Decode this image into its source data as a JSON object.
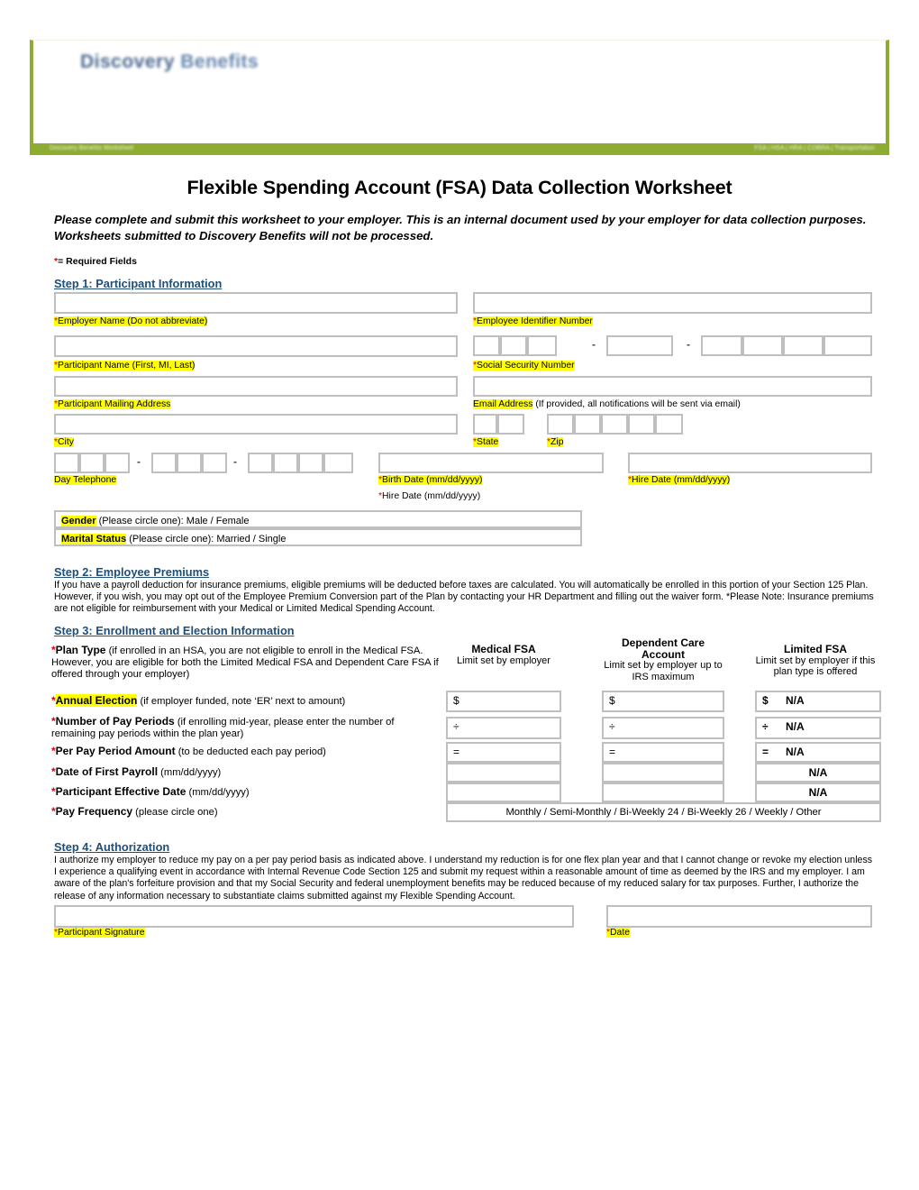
{
  "banner": {
    "logo_primary": "Discovery",
    "logo_secondary": "Benefits",
    "bar_left_text": "Discovery Benefits Worksheet",
    "bar_right_text": "FSA  |  HSA  |  HRA  |  COBRA  |  Transportation"
  },
  "title": "Flexible Spending Account (FSA) Data Collection Worksheet",
  "intro": "Please complete and submit this worksheet to your employer.  This is an internal document used by your employer for data collection purposes.  Worksheets submitted to Discovery Benefits will not be processed.",
  "required_fields_note": "= Required Fields",
  "step1": {
    "heading": "Step 1: Participant Information",
    "employer_name_label": "Employer Name (Do not abbreviate)",
    "employee_id_label": "Employee Identifier Number",
    "participant_name_label": "Participant Name (First, MI, Last)",
    "ssn_label": "Social Security Number",
    "mailing_address_label": "Participant Mailing Address",
    "email_label": "Email Address",
    "email_note": "(If provided, all notifications will be sent via email)",
    "city_label": "City",
    "state_label": "State",
    "zip_label": "Zip",
    "day_telephone_label": "Day Telephone",
    "birth_date_label": "Birth Date (mm/dd/yyyy)",
    "hire_date_label": "Hire Date (mm/dd/yyyy)",
    "hire_date_label_dup": "Hire Date (mm/dd/yyyy)",
    "gender_label": "Gender",
    "gender_note": "(Please circle one): Male  /  Female",
    "marital_label": "Marital Status",
    "marital_note": "(Please circle one): Married  /  Single"
  },
  "step2": {
    "heading": "Step 2: Employee Premiums",
    "body": "If you have a payroll deduction for insurance premiums, eligible premiums will be deducted before taxes are calculated.  You will automatically be enrolled in this portion of your Section 125 Plan.  However, if you wish, you may opt out of the Employee Premium Conversion part of the Plan by contacting your HR Department and filling out the waiver form.  *Please Note: Insurance premiums are not eligible for reimbursement with your Medical or Limited Medical Spending Account."
  },
  "step3": {
    "heading": "Step 3: Enrollment and Election Information",
    "plan_type_bold": "Plan Type",
    "plan_type_note": "(if enrolled in an HSA, you are not eligible to enroll in the Medical FSA. However, you are eligible for both the Limited Medical FSA and Dependent Care FSA if offered through your employer)",
    "columns": [
      {
        "title": "Medical FSA",
        "sub": "Limit set by employer"
      },
      {
        "title": "Dependent Care Account",
        "sub": "Limit set by employer up to IRS maximum"
      },
      {
        "title": "Limited FSA",
        "sub": "Limit set by employer if this plan type is offered"
      }
    ],
    "rows": [
      {
        "label_bold": "Annual Election",
        "label_note": "(if employer funded, note ‘ER’ next to amount)",
        "label_highlight": true,
        "cells": [
          {
            "symbol": "$",
            "value": ""
          },
          {
            "symbol": "$",
            "value": ""
          },
          {
            "symbol": "$",
            "value": "N/A"
          }
        ]
      },
      {
        "label_bold": "Number of Pay Periods",
        "label_note": "(if enrolling mid-year, please enter the number of remaining pay periods within the plan year)",
        "label_highlight": false,
        "cells": [
          {
            "symbol": "÷",
            "value": ""
          },
          {
            "symbol": "÷",
            "value": ""
          },
          {
            "symbol": "÷",
            "value": "N/A"
          }
        ]
      },
      {
        "label_bold": "Per Pay Period Amount",
        "label_note": "(to be deducted each pay period)",
        "label_highlight": false,
        "cells": [
          {
            "symbol": "=",
            "value": ""
          },
          {
            "symbol": "=",
            "value": ""
          },
          {
            "symbol": "=",
            "value": "N/A"
          }
        ]
      },
      {
        "label_bold": "Date of First Payroll",
        "label_note": "(mm/dd/yyyy)",
        "label_highlight": false,
        "cells": [
          {
            "symbol": "",
            "value": ""
          },
          {
            "symbol": "",
            "value": ""
          },
          {
            "symbol": "",
            "value": "N/A"
          }
        ]
      },
      {
        "label_bold": "Participant Effective Date",
        "label_note": "(mm/dd/yyyy)",
        "label_highlight": false,
        "cells": [
          {
            "symbol": "",
            "value": ""
          },
          {
            "symbol": "",
            "value": ""
          },
          {
            "symbol": "",
            "value": "N/A"
          }
        ]
      }
    ],
    "pay_frequency_bold": "Pay Frequency",
    "pay_frequency_note": "(please circle one)",
    "pay_frequency_options": "Monthly  /  Semi-Monthly  /  Bi-Weekly 24  /  Bi-Weekly 26  /  Weekly  /  Other"
  },
  "step4": {
    "heading": "Step 4: Authorization ",
    "body": "I authorize my employer to reduce my pay on a per pay period basis as indicated above.  I understand my reduction is for one flex plan year and that I cannot change or revoke my election unless I experience a qualifying event in accordance with Internal Revenue Code Section 125 and submit my request within a reasonable amount of time as deemed by the IRS and my employer.  I am aware of the plan's forfeiture provision and that my Social Security and federal unemployment benefits may be reduced because of my reduced salary for tax purposes.  Further, I authorize the release of any information necessary to substantiate claims submitted against my Flexible Spending Account.",
    "signature_label": "Participant Signature",
    "date_label": "Date"
  },
  "colors": {
    "green": "#8fac32",
    "step_blue": "#1f4e79",
    "highlight": "#ffff00",
    "required_red": "#e00000",
    "box_border": "#bfbfbf"
  }
}
